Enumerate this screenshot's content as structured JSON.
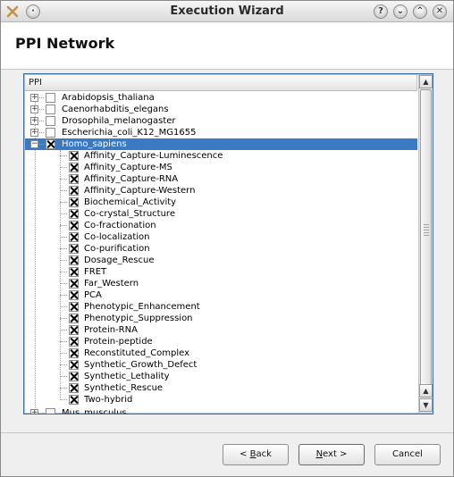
{
  "window": {
    "title": "Execution Wizard",
    "buttons": [
      "?",
      "⌄",
      "⌃",
      "✕"
    ]
  },
  "header": {
    "page_title": "PPI Network"
  },
  "tree": {
    "column_header": "PPI",
    "organisms": [
      {
        "label": "Arabidopsis_thaliana",
        "expanded": false,
        "checked": false
      },
      {
        "label": "Caenorhabditis_elegans",
        "expanded": false,
        "checked": false
      },
      {
        "label": "Drosophila_melanogaster",
        "expanded": false,
        "checked": false
      },
      {
        "label": "Escherichia_coli_K12_MG1655",
        "expanded": false,
        "checked": false
      },
      {
        "label": "Homo_sapiens",
        "expanded": true,
        "checked": true,
        "selected": true
      }
    ],
    "children": [
      "Affinity_Capture-Luminescence",
      "Affinity_Capture-MS",
      "Affinity_Capture-RNA",
      "Affinity_Capture-Western",
      "Biochemical_Activity",
      "Co-crystal_Structure",
      "Co-fractionation",
      "Co-localization",
      "Co-purification",
      "Dosage_Rescue",
      "FRET",
      "Far_Western",
      "PCA",
      "Phenotypic_Enhancement",
      "Phenotypic_Suppression",
      "Protein-RNA",
      "Protein-peptide",
      "Reconstituted_Complex",
      "Synthetic_Growth_Defect",
      "Synthetic_Lethality",
      "Synthetic_Rescue",
      "Two-hybrid"
    ],
    "partial_row": "Mus_musculus"
  },
  "footer": {
    "back_prefix": "< ",
    "back_mnemonic": "B",
    "back_rest": "ack",
    "next_mnemonic": "N",
    "next_rest": "ext >",
    "cancel_label": "Cancel"
  }
}
